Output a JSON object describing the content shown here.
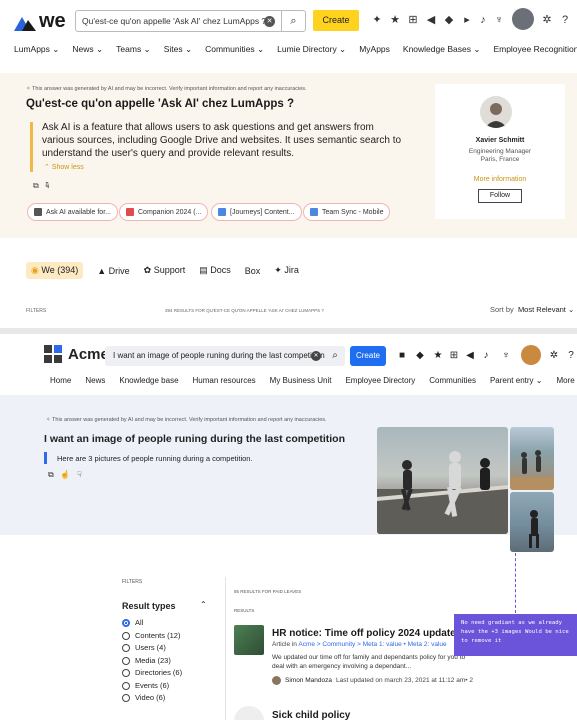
{
  "top": {
    "brand": "we",
    "search_value": "Qu'est-ce qu'on appelle 'Ask AI' chez LumApps ?",
    "create_label": "Create",
    "nav": [
      "LumApps ⌄",
      "News ⌄",
      "Teams ⌄",
      "Sites ⌄",
      "Communities ⌄",
      "Lumie Directory ⌄",
      "MyApps",
      "Knowledge Bases ⌄",
      "Employee Recognition ⌄"
    ],
    "disclaimer": "This answer was generated by AI and may be incorrect. Verify important information and report any inaccuracies.",
    "question": "Qu'est-ce qu'on appelle 'Ask AI' chez LumApps ?",
    "answer": "Ask AI is a feature that allows users to ask questions and get answers from various sources, including Google Drive and websites. It uses semantic search to understand the user's query and provide relevant results.",
    "show_less": "Show less",
    "chips": [
      {
        "label": "Ask AI available for...",
        "color": "#555555"
      },
      {
        "label": "Companion 2024 (...",
        "color": "#e04b4b"
      },
      {
        "label": "[Journeys] Content...",
        "color": "#4b86e0"
      },
      {
        "label": "Team Sync - Mobile",
        "color": "#4b86e0"
      }
    ],
    "person": {
      "name": "Xavier Schmitt",
      "role": "Engineering Manager",
      "location": "Paris, France",
      "more": "More information",
      "follow": "Follow"
    },
    "tabs": [
      "We (394)",
      "Drive",
      "Support",
      "Docs",
      "Box",
      "Jira"
    ],
    "filters_label": "FILTERS",
    "results_label": "394 RESULTS FOR QU'EST-CE QU'ON APPELLE 'ASK AI' CHEZ LUMAPPS ?",
    "sort_label": "Sort by",
    "sort_value": "Most Relevant ⌄"
  },
  "bottom": {
    "brand": "Acme",
    "search_value": "I want an image of people runing during the last competition",
    "create_label": "Create",
    "nav": [
      "Home",
      "News",
      "Knowledge base",
      "Human resources",
      "My Business Unit",
      "Employee Directory",
      "Communities",
      "Parent entry ⌄",
      "More ⌄"
    ],
    "disclaimer": "This answer was generated by AI and may be incorrect. Verify important information and report any inaccuracies.",
    "question": "I want an image of people runing during the last competition",
    "answer": "Here are 3 pictures of people running during a competition.",
    "filters_label": "FILTERS",
    "result_types_title": "Result types",
    "result_types": [
      "All",
      "Contents (12)",
      "Users (4)",
      "Media (23)",
      "Directories (6)",
      "Events (6)",
      "Video (6)"
    ],
    "results_count": "85 RESULTS FOR PAID LEAVES",
    "results_header": "RESULTS",
    "item1": {
      "title": "HR notice: Time off policy 2024 update",
      "type": "Article in",
      "breadcrumb": "Acme > Community > Meta 1: value • Meta 2: value",
      "desc": "We updated our time off for family and dependants policy for you to deal with an emergency involving a dependant...",
      "author": "Simon Mandoza",
      "updated": "Last updated on march 23, 2021 at 11:12 am• 2"
    },
    "item2_title": "Sick child policy",
    "note": "No need gradiant as we already have the +3 images Would be nice to remove it"
  }
}
